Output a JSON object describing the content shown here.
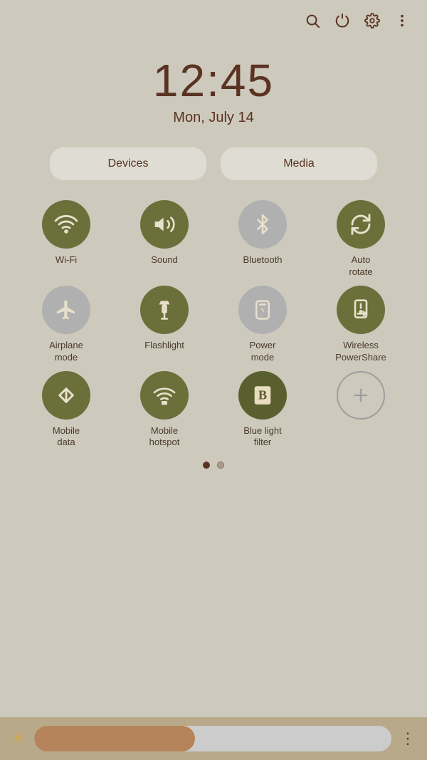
{
  "toolbar": {
    "icons": [
      "search-icon",
      "power-icon",
      "settings-icon",
      "more-icon"
    ]
  },
  "clock": {
    "time": "12:45",
    "date": "Mon, July 14"
  },
  "tabs": {
    "devices_label": "Devices",
    "media_label": "Media"
  },
  "tiles": [
    {
      "id": "wifi",
      "label": "Wi-Fi",
      "state": "active",
      "icon": "wifi"
    },
    {
      "id": "sound",
      "label": "Sound",
      "state": "active",
      "icon": "sound"
    },
    {
      "id": "bluetooth",
      "label": "Bluetooth",
      "state": "inactive",
      "icon": "bluetooth"
    },
    {
      "id": "autorotate",
      "label": "Auto\nrotate",
      "state": "active",
      "icon": "rotate"
    },
    {
      "id": "airplane",
      "label": "Airplane\nmode",
      "state": "inactive",
      "icon": "airplane"
    },
    {
      "id": "flashlight",
      "label": "Flashlight",
      "state": "active",
      "icon": "flashlight"
    },
    {
      "id": "powermode",
      "label": "Power\nmode",
      "state": "inactive",
      "icon": "powermode"
    },
    {
      "id": "wireless",
      "label": "Wireless\nPowerShare",
      "state": "active",
      "icon": "wireless"
    },
    {
      "id": "mobiledata",
      "label": "Mobile\ndata",
      "state": "active",
      "icon": "mobiledata"
    },
    {
      "id": "hotspot",
      "label": "Mobile\nhotspot",
      "state": "active",
      "icon": "hotspot"
    },
    {
      "id": "bluelight",
      "label": "Blue light\nfilter",
      "state": "active",
      "icon": "bluelight"
    },
    {
      "id": "add",
      "label": "",
      "state": "plus",
      "icon": "plus"
    }
  ],
  "brightness": {
    "level": 45
  },
  "dots": {
    "active": 0,
    "total": 2
  }
}
